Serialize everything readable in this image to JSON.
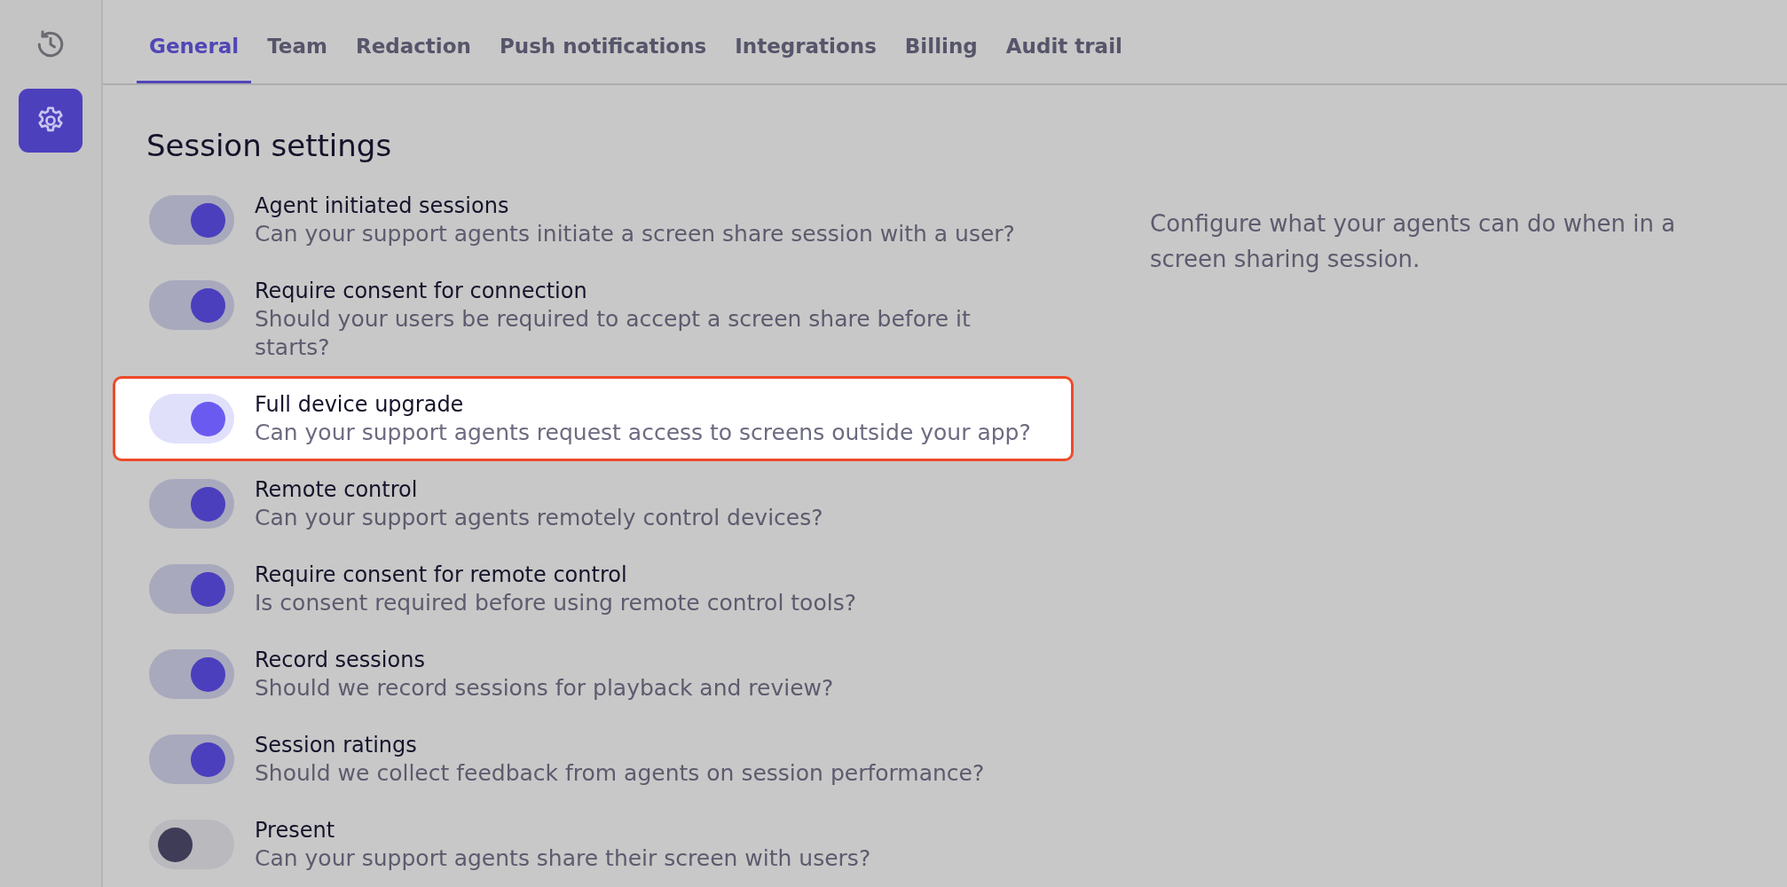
{
  "sidebar": {
    "items": [
      {
        "kind": "history",
        "selected": false
      },
      {
        "kind": "settings",
        "selected": true
      }
    ]
  },
  "tabs": [
    {
      "label": "General",
      "selected": true
    },
    {
      "label": "Team",
      "selected": false
    },
    {
      "label": "Redaction",
      "selected": false
    },
    {
      "label": "Push notifications",
      "selected": false
    },
    {
      "label": "Integrations",
      "selected": false
    },
    {
      "label": "Billing",
      "selected": false
    },
    {
      "label": "Audit trail",
      "selected": false
    }
  ],
  "section": {
    "title": "Session settings",
    "description": "Configure what your agents can do when in a screen sharing session.",
    "settings": [
      {
        "title": "Agent initiated sessions",
        "description": "Can your support agents initiate a screen share session with a user?",
        "on": true,
        "highlighted": false
      },
      {
        "title": "Require consent for connection",
        "description": "Should your users be required to accept a screen share before it starts?",
        "on": true,
        "highlighted": false
      },
      {
        "title": "Full device upgrade",
        "description": "Can your support agents request access to screens outside your app?",
        "on": true,
        "highlighted": true
      },
      {
        "title": "Remote control",
        "description": "Can your support agents remotely control devices?",
        "on": true,
        "highlighted": false
      },
      {
        "title": "Require consent for remote control",
        "description": "Is consent required before using remote control tools?",
        "on": true,
        "highlighted": false
      },
      {
        "title": "Record sessions",
        "description": "Should we record sessions for playback and review?",
        "on": true,
        "highlighted": false
      },
      {
        "title": "Session ratings",
        "description": "Should we collect feedback from agents on session performance?",
        "on": true,
        "highlighted": false
      },
      {
        "title": "Present",
        "description": "Can your support agents share their screen with users?",
        "on": false,
        "highlighted": false
      }
    ]
  }
}
